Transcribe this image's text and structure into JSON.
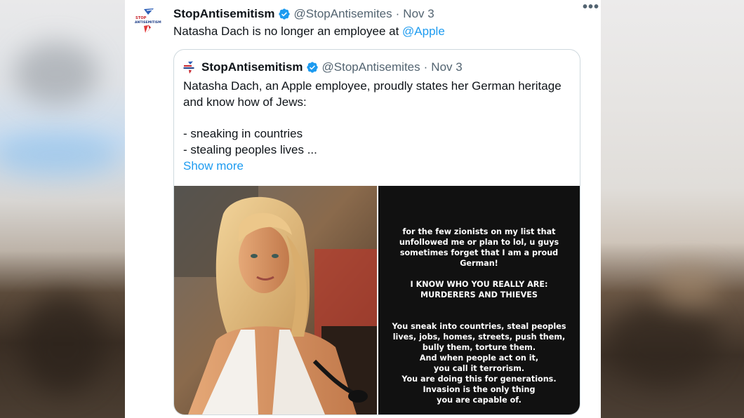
{
  "tweet": {
    "author_name": "StopAntisemitism",
    "handle": "@StopAntisemites",
    "dot": "·",
    "date": "Nov 3",
    "more_label": "•••",
    "text": "Natasha Dach is no longer an employee at ",
    "mention": "@Apple",
    "logo_text_top": "STOP",
    "logo_text_bottom": "ANTISEMITISM"
  },
  "quoted": {
    "author_name": "StopAntisemitism",
    "handle": "@StopAntisemites",
    "dot": "·",
    "date": "Nov 3",
    "lines": [
      "Natasha Dach, an Apple employee, proudly states her German heritage",
      "and know how of Jews:",
      "",
      "- sneaking in countries",
      "- stealing peoples lives ..."
    ],
    "show_more": "Show more",
    "story_lines": [
      "for the few zionists on my list that",
      "unfollowed me or plan to lol, u guys",
      "sometimes forget that I am a proud",
      "German!",
      "",
      "I KNOW WHO YOU REALLY ARE:",
      "MURDERERS AND THIEVES",
      "",
      "",
      "You sneak into countries, steal peoples",
      "lives, jobs, homes, streets, push them,",
      "bully them, torture them.",
      "And when people act on it,",
      "you call it terrorism.",
      "You are doing this for generations.",
      "Invasion is the only thing",
      "you are capable of."
    ]
  },
  "colors": {
    "link": "#1d9bf0",
    "verified": "#1d9bf0",
    "secondary_text": "#536471",
    "story_background": "#111111"
  }
}
